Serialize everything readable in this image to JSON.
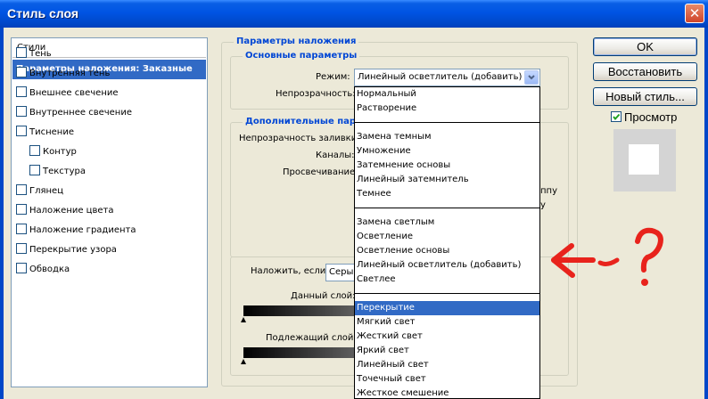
{
  "window": {
    "title": "Стиль слоя",
    "close_glyph": "✕"
  },
  "left_panel": {
    "header": "Стили",
    "selected": "Параметры наложения: Заказные",
    "items": [
      {
        "label": "Тень"
      },
      {
        "label": "Внутренняя тень"
      },
      {
        "label": "Внешнее свечение"
      },
      {
        "label": "Внутреннее свечение"
      },
      {
        "label": "Тиснение"
      },
      {
        "label": "Контур"
      },
      {
        "label": "Текстура"
      },
      {
        "label": "Глянец"
      },
      {
        "label": "Наложение цвета"
      },
      {
        "label": "Наложение градиента"
      },
      {
        "label": "Перекрытие узора"
      },
      {
        "label": "Обводка"
      }
    ]
  },
  "blending": {
    "section_title": "Параметры наложения",
    "basic_title": "Основные параметры",
    "mode_label": "Режим:",
    "mode_value": "Линейный осветлитель (добавить)",
    "opacity_label": "Непрозрачность:",
    "advanced_title": "Дополнительные параметры",
    "fill_opacity_label": "Непрозрачность заливки:",
    "channels_label": "Каналы:",
    "knockout_label": "Просвечивание:",
    "partial_right_1": "ппу",
    "partial_right_2": "у",
    "blend_if_label": "Наложить, если:",
    "blend_if_value": "Серый",
    "this_layer_label": "Данный слой:",
    "underlying_label": "Подлежащий слой:"
  },
  "dropdown": {
    "selected_index": 12,
    "groups": [
      [
        "Нормальный",
        "Растворение"
      ],
      [
        "Замена темным",
        "Умножение",
        "Затемнение основы",
        "Линейный затемнитель",
        "Темнее"
      ],
      [
        "Замена светлым",
        "Осветление",
        "Осветление основы",
        "Линейный осветлитель (добавить)",
        "Светлее"
      ],
      [
        "Перекрытие",
        "Мягкий свет",
        "Жесткий свет",
        "Яркий свет",
        "Линейный свет",
        "Точечный свет",
        "Жесткое смешение"
      ]
    ]
  },
  "buttons": {
    "ok": "OK",
    "reset": "Восстановить",
    "new_style": "Новый стиль...",
    "preview_label": "Просмотр",
    "preview_checked": true
  },
  "annotation": {
    "color": "#e8231c"
  },
  "colors": {
    "title_bar": "#0054e3",
    "selection": "#316ac5",
    "dialog_bg": "#ece9d8"
  }
}
